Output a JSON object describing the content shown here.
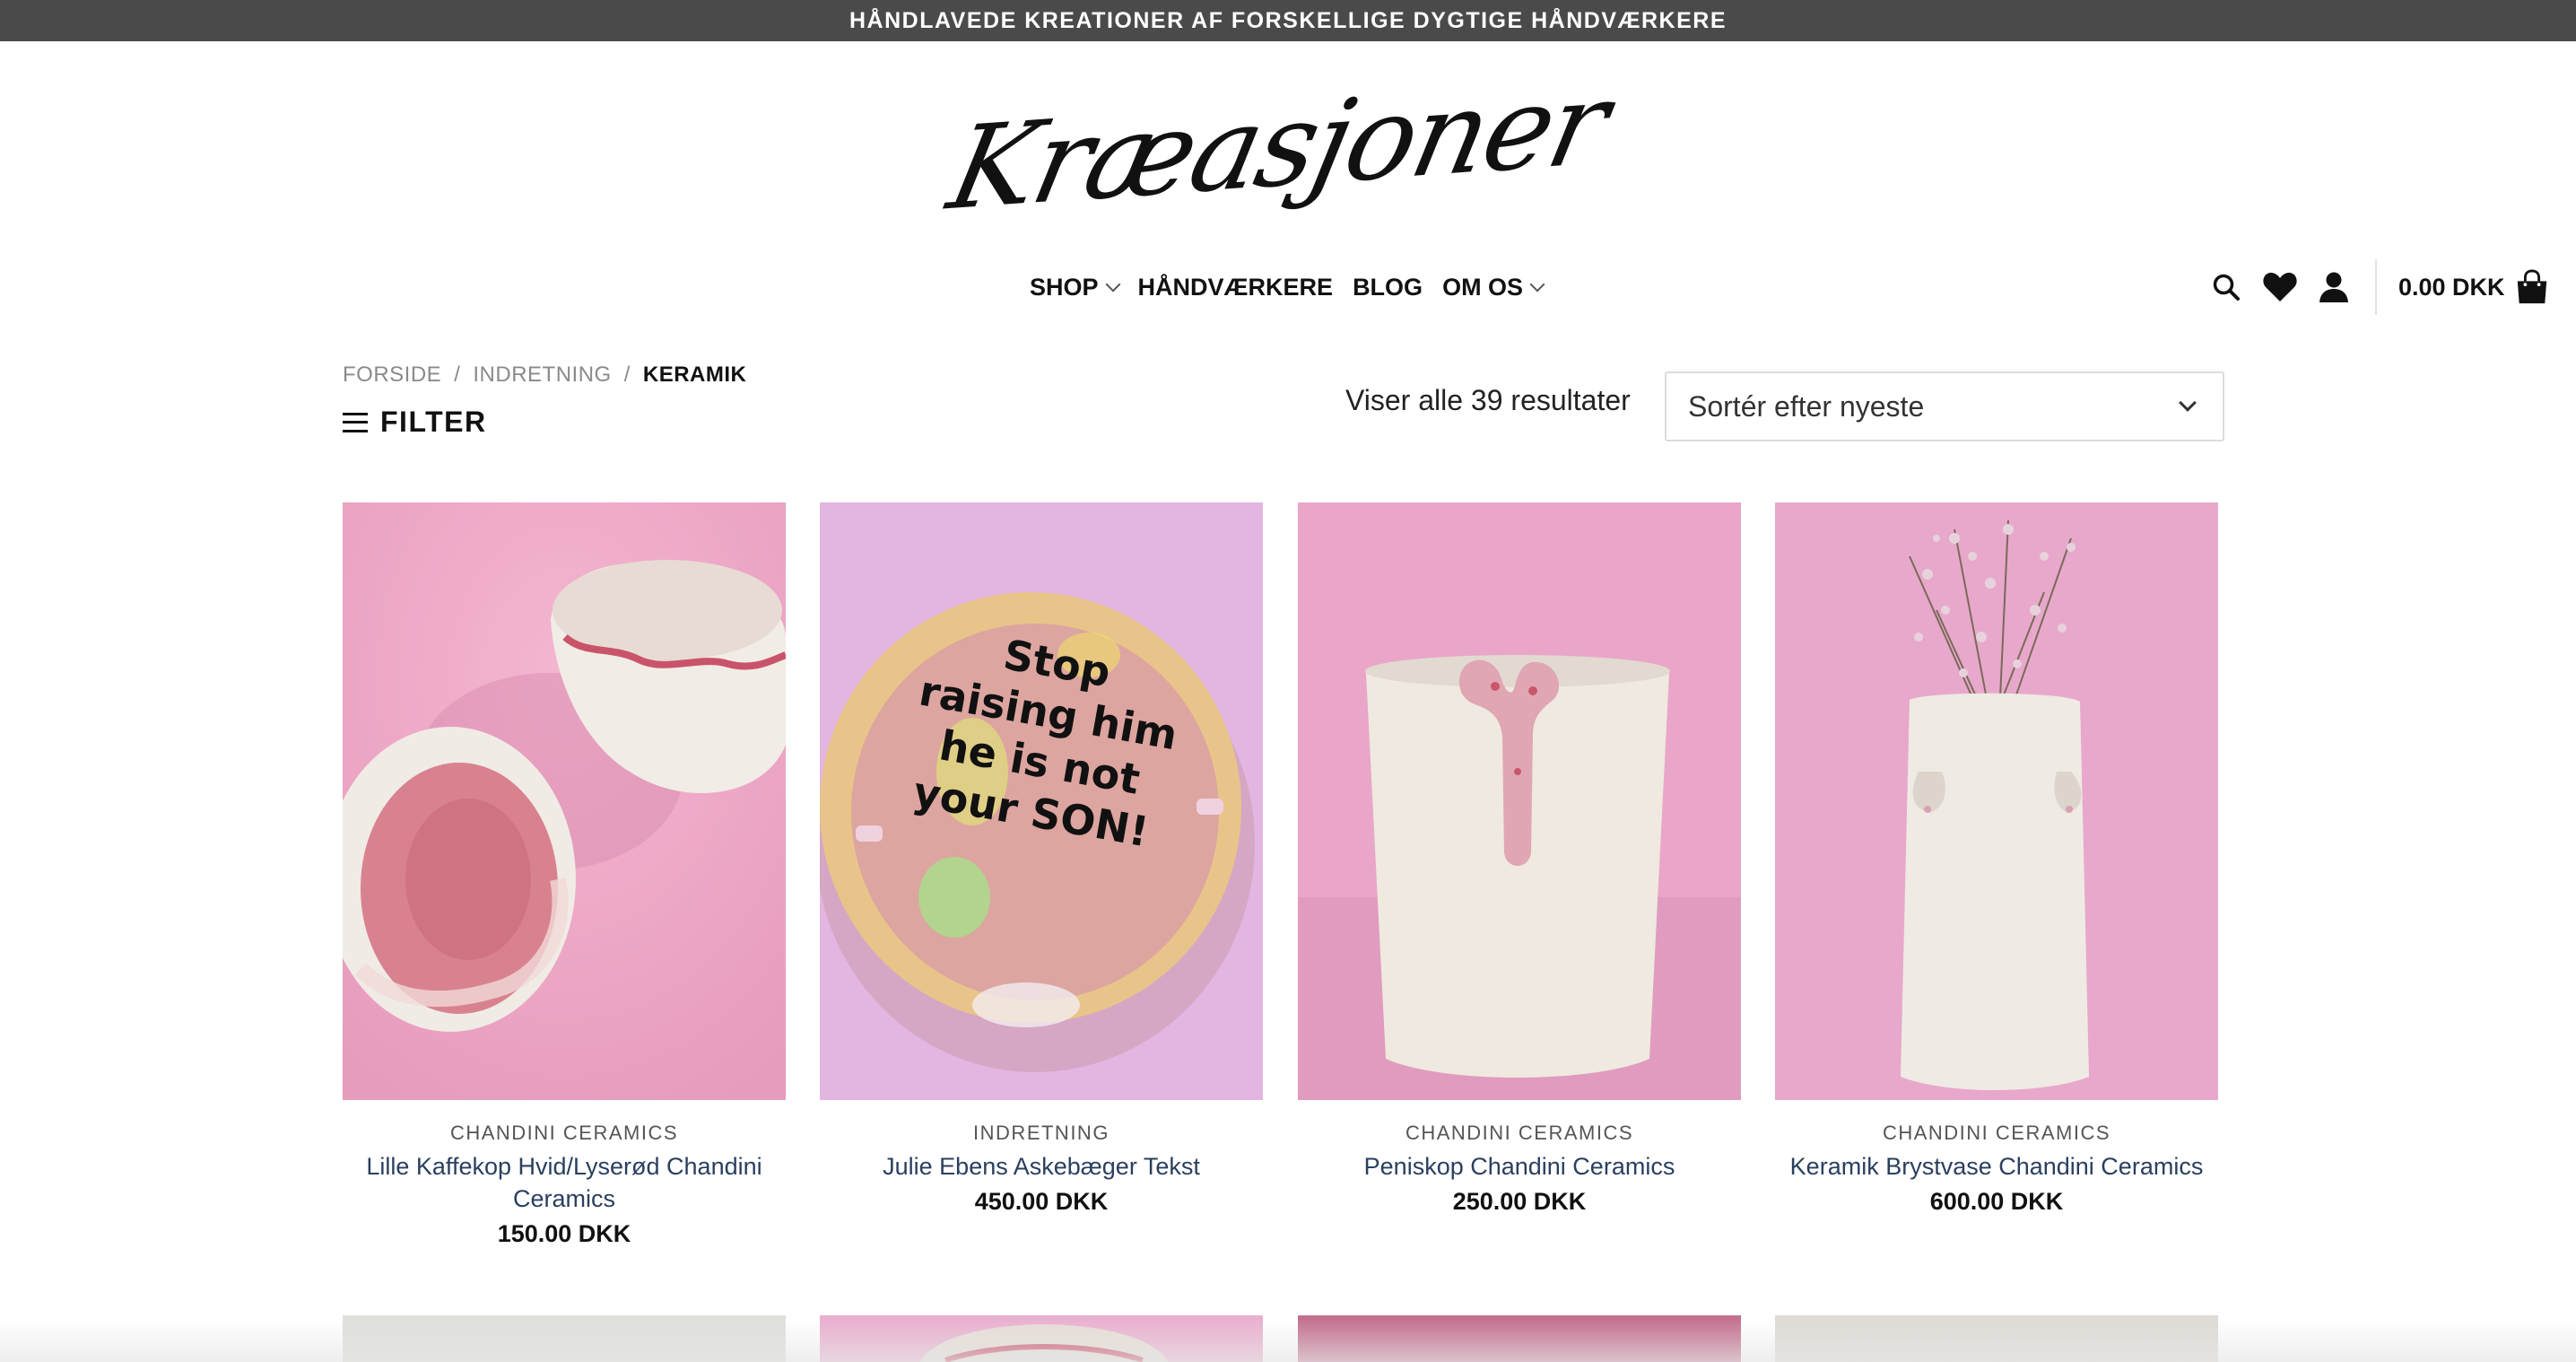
{
  "announcement": "HÅNDLAVEDE KREATIONER AF FORSKELLIGE DYGTIGE HÅNDVÆRKERE",
  "logo": "Kræasjoner",
  "nav": {
    "items": [
      {
        "label": "SHOP",
        "dropdown": true
      },
      {
        "label": "HÅNDVÆRKERE",
        "dropdown": false
      },
      {
        "label": "BLOG",
        "dropdown": false
      },
      {
        "label": "OM OS",
        "dropdown": true
      }
    ]
  },
  "header": {
    "icons": [
      "search-icon",
      "heart-icon",
      "user-icon"
    ],
    "cart_total": "0.00 DKK"
  },
  "breadcrumb": {
    "items": [
      "FORSIDE",
      "INDRETNING",
      "KERAMIK"
    ],
    "separator": "/"
  },
  "filter_label": "FILTER",
  "results_text": "Viser alle 39 resultater",
  "sort": {
    "selected": "Sortér efter nyeste"
  },
  "products": [
    {
      "category": "CHANDINI CERAMICS",
      "name": "Lille Kaffekop Hvid/Lyserød Chandini Ceramics",
      "price": "150.00 DKK"
    },
    {
      "category": "INDRETNING",
      "name": "Julie Ebens Askebæger Tekst",
      "price": "450.00 DKK",
      "image_text": [
        "Stop",
        "raising him",
        "he is not",
        "your SON!"
      ]
    },
    {
      "category": "CHANDINI CERAMICS",
      "name": "Peniskop Chandini Ceramics",
      "price": "250.00 DKK"
    },
    {
      "category": "CHANDINI CERAMICS",
      "name": "Keramik Brystvase Chandini Ceramics",
      "price": "600.00 DKK"
    }
  ],
  "colors": {
    "topbar": "#4a4a4a",
    "link": "#2a3f5f",
    "pink_bg": "#e8a6c6",
    "lilac_bg": "#e2b6df"
  }
}
